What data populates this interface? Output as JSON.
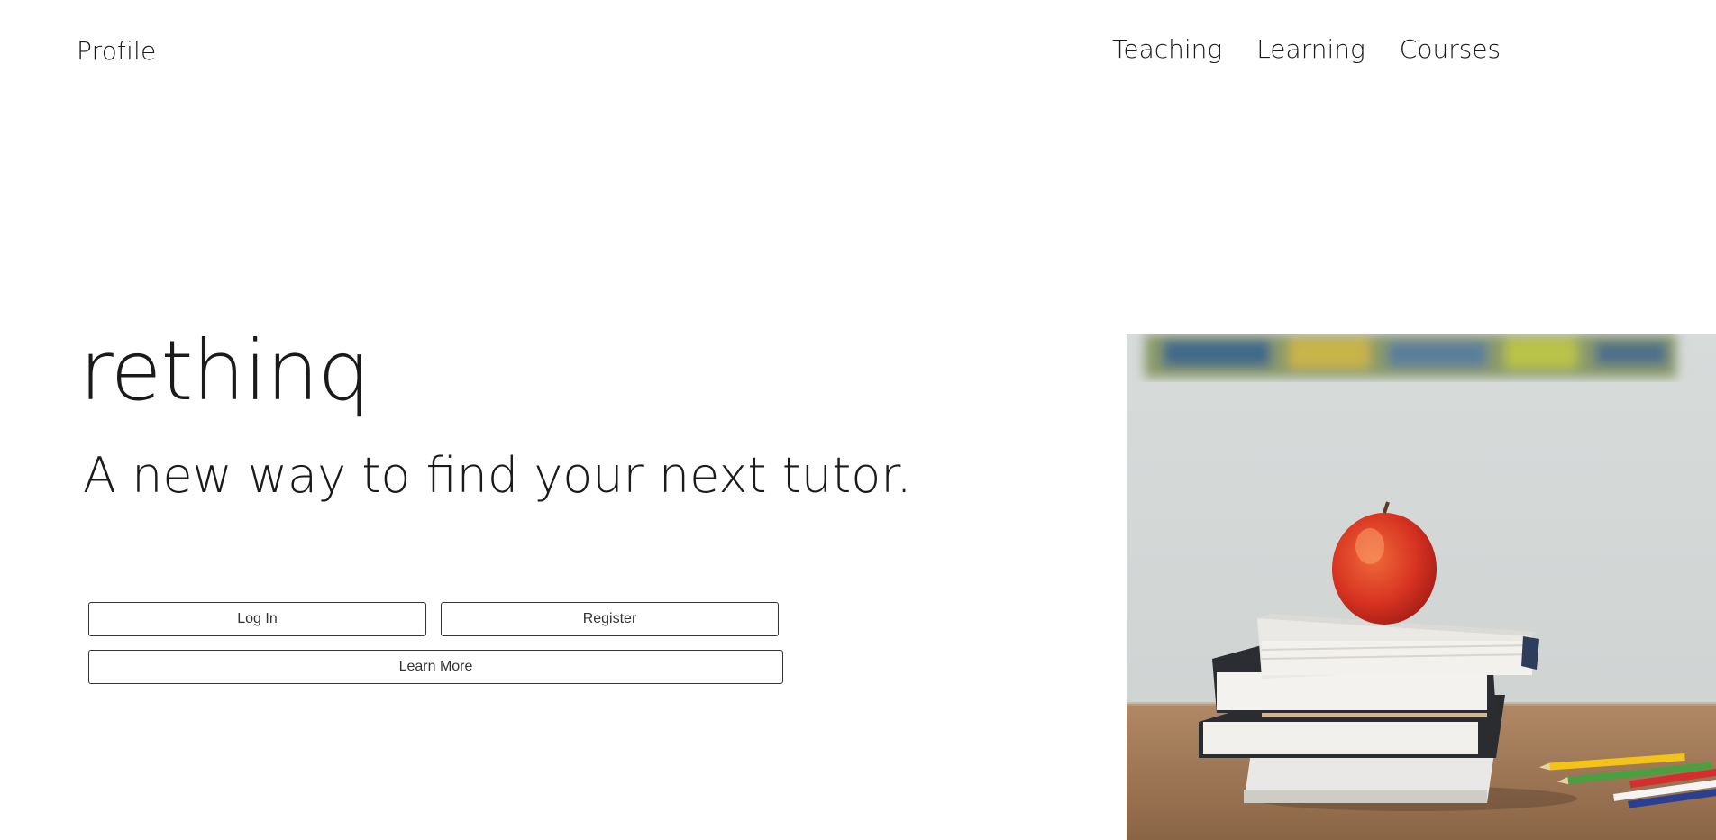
{
  "header": {
    "profile_label": "Profile",
    "nav": [
      "Teaching",
      "Learning",
      "Courses"
    ]
  },
  "hero": {
    "brand": "rethinq",
    "tagline": "A new way to find your next tutor."
  },
  "actions": {
    "login_label": "Log In",
    "register_label": "Register",
    "learn_more_label": "Learn More"
  },
  "image": {
    "subject": "apple on stack of books with colored pencils"
  }
}
